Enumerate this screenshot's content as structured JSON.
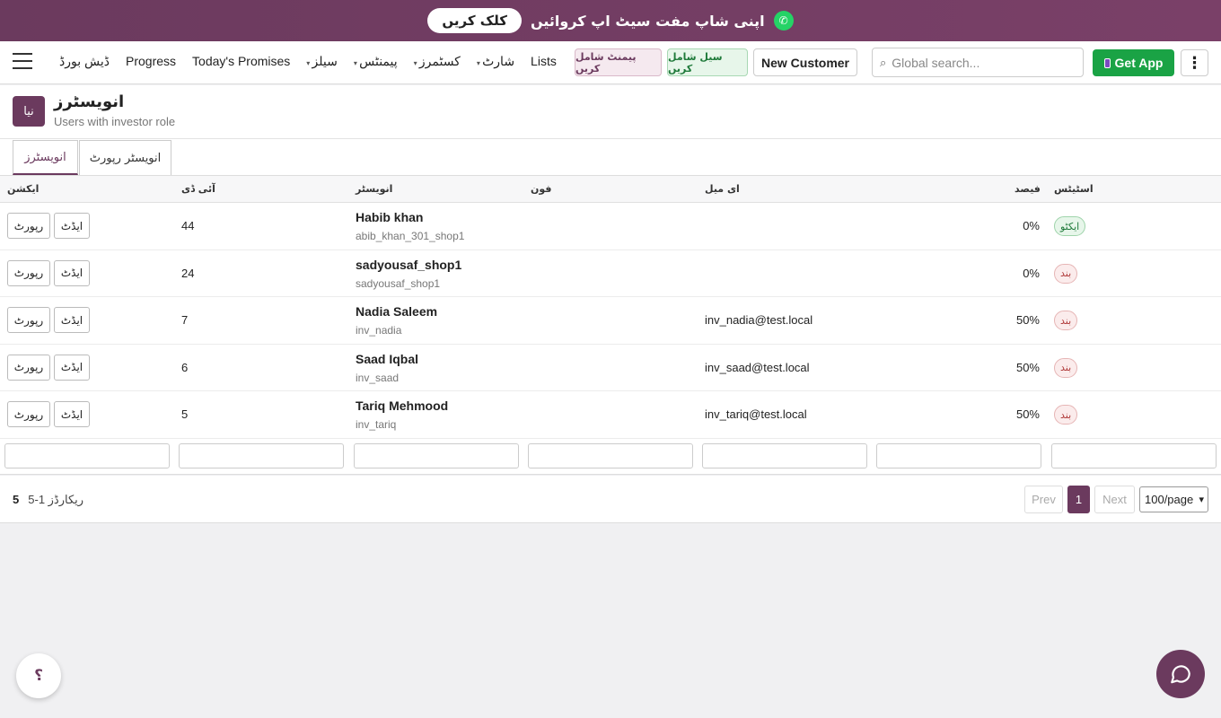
{
  "banner": {
    "text": "اپنی شاپ مفت سیٹ اپ کروائیں",
    "button": "کلک کریں"
  },
  "nav": {
    "links": [
      {
        "label": "ڈیش بورڈ",
        "dropdown": false
      },
      {
        "label": "Progress",
        "dropdown": false
      },
      {
        "label": "Today's Promises",
        "dropdown": false
      },
      {
        "label": "سیلز",
        "dropdown": true
      },
      {
        "label": "پیمنٹس",
        "dropdown": true
      },
      {
        "label": "کسٹمرز",
        "dropdown": true
      },
      {
        "label": "شارٹ",
        "dropdown": true
      },
      {
        "label": "Lists",
        "dropdown": false
      }
    ],
    "add_payment": "پیمنٹ شامل کریں",
    "add_sale": "سیل شامل کریں",
    "new_customer": "New Customer",
    "search_placeholder": "Global search...",
    "get_app": "Get App"
  },
  "page": {
    "title": "انویسٹرز",
    "subtitle": "Users with investor role",
    "new_button": "نیا"
  },
  "tabs": [
    {
      "label": "انویسٹرز"
    },
    {
      "label": "انویسٹر رپورٹ"
    }
  ],
  "table": {
    "headers": {
      "action": "ایکشن",
      "id": "آئی ڈی",
      "investor": "انویسٹر",
      "phone": "فون",
      "email": "ای میل",
      "percent": "فیصد",
      "status": "اسٹیٹس"
    },
    "report_label": "رپورٹ",
    "edit_label": "ایڈٹ",
    "rows": [
      {
        "id": "44",
        "name": "Habib khan",
        "username": "abib_khan_301_shop1",
        "email": "",
        "percent": "0%",
        "status": "ایکٹو",
        "active": true
      },
      {
        "id": "24",
        "name": "sadyousaf_shop1",
        "username": "sadyousaf_shop1",
        "email": "",
        "percent": "0%",
        "status": "بند",
        "active": false
      },
      {
        "id": "7",
        "name": "Nadia Saleem",
        "username": "inv_nadia",
        "email": "inv_nadia@test.local",
        "percent": "50%",
        "status": "بند",
        "active": false
      },
      {
        "id": "6",
        "name": "Saad Iqbal",
        "username": "inv_saad",
        "email": "inv_saad@test.local",
        "percent": "50%",
        "status": "بند",
        "active": false
      },
      {
        "id": "5",
        "name": "Tariq Mehmood",
        "username": "inv_tariq",
        "email": "inv_tariq@test.local",
        "percent": "50%",
        "status": "بند",
        "active": false
      }
    ]
  },
  "pager": {
    "total": "5",
    "range": "ریکارڈز 1-5",
    "prev": "Prev",
    "current": "1",
    "next": "Next",
    "page_size": "100/page"
  },
  "help": "؟",
  "colors": {
    "brand": "#6b3a5e",
    "success": "#1aa345",
    "whatsapp": "#25d366"
  }
}
